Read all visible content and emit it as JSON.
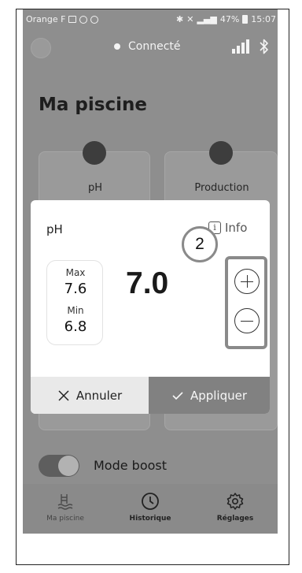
{
  "status_bar": {
    "carrier": "Orange F",
    "battery": "47%",
    "time": "15:07"
  },
  "connection": {
    "label": "Connecté"
  },
  "page": {
    "title": "Ma piscine"
  },
  "cards": [
    {
      "label": "pH",
      "icon": "ph-probe-icon"
    },
    {
      "label": "Production",
      "icon": "production-icon"
    }
  ],
  "boost": {
    "label": "Mode boost",
    "enabled": true
  },
  "bottom_nav": [
    {
      "label": "Ma piscine",
      "icon": "pool-ladder-icon",
      "active": true
    },
    {
      "label": "Historique",
      "icon": "clock-icon",
      "active": false
    },
    {
      "label": "Réglages",
      "icon": "gear-icon",
      "active": false
    }
  ],
  "modal": {
    "title": "pH",
    "info_label": "Info",
    "info_icon_glyph": "i",
    "max_label": "Max",
    "max_value": "7.6",
    "min_label": "Min",
    "min_value": "6.8",
    "value": "7.0",
    "cancel_label": "Annuler",
    "apply_label": "Appliquer"
  },
  "annotation": {
    "number": "2"
  }
}
